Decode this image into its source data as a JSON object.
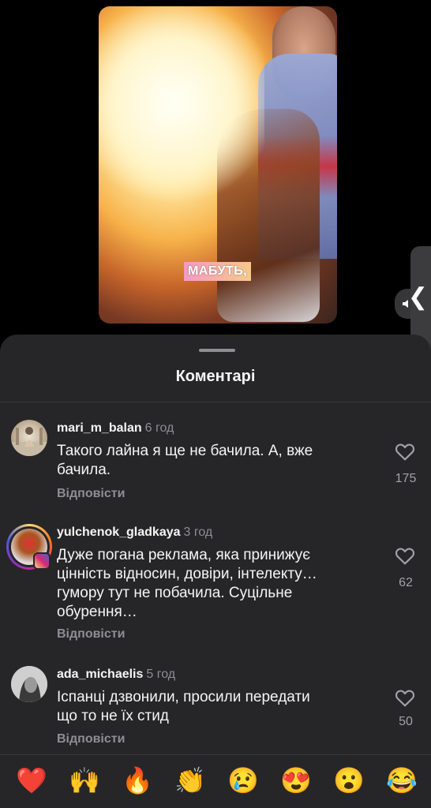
{
  "video": {
    "caption": "МАБУТЬ,"
  },
  "sheet": {
    "title": "Коментарі"
  },
  "comments": [
    {
      "username": "mari_m_balan",
      "time": "6 год",
      "text": "Такого лайна я ще не бачила. А, вже бачила.",
      "reply": "Відповісти",
      "likes": "175"
    },
    {
      "username": "yulchenok_gladkaya",
      "time": "3 год",
      "text": "Дуже погана реклама, яка принижує цінність відносин, довіри, інтелекту… гумору тут не побачила. Суцільне обурення…",
      "reply": "Відповісти",
      "likes": "62"
    },
    {
      "username": "ada_michaelis",
      "time": "5 год",
      "text": "Іспанці дзвонили, просили передати що то не їх стид",
      "reply": "Відповісти",
      "likes": "50"
    }
  ],
  "reactions": [
    "❤️",
    "🙌",
    "🔥",
    "👏",
    "😢",
    "😍",
    "😮",
    "😂"
  ]
}
